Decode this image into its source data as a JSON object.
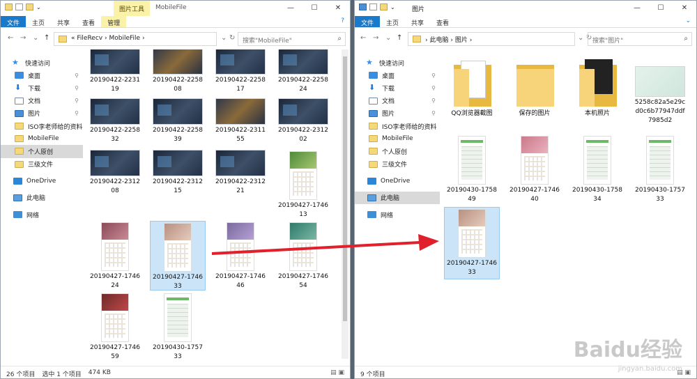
{
  "left": {
    "title": "MobileFile",
    "ctx_tab": "图片工具",
    "ribbon": [
      "文件",
      "主页",
      "共享",
      "查看",
      "管理"
    ],
    "path": [
      "«",
      "FileRecv",
      "›",
      "MobileFile",
      "›"
    ],
    "search_placeholder": "搜索\"MobileFile\"",
    "nav": [
      {
        "label": "快速访问",
        "icon": "star-icon"
      },
      {
        "label": "桌面",
        "icon": "desktop-icon",
        "pin": "true"
      },
      {
        "label": "下载",
        "icon": "download-icon",
        "pin": "true"
      },
      {
        "label": "文档",
        "icon": "document-icon",
        "pin": "true"
      },
      {
        "label": "图片",
        "icon": "pictures-icon",
        "pin": "true"
      },
      {
        "label": "ISO李老师给的资料",
        "icon": "folder-icon"
      },
      {
        "label": "MobileFile",
        "icon": "folder-icon"
      },
      {
        "label": "个人原创",
        "icon": "folder-icon",
        "selected": true
      },
      {
        "label": "三级文件",
        "icon": "folder-icon"
      },
      {
        "label": "OneDrive",
        "icon": "onedrive-icon"
      },
      {
        "label": "此电脑",
        "icon": "this-pc-icon"
      },
      {
        "label": "网络",
        "icon": "network-icon"
      }
    ],
    "files": [
      {
        "name": [
          "20190422-2231",
          "19"
        ],
        "kind": "land"
      },
      {
        "name": [
          "20190422-2258",
          "08"
        ],
        "kind": "hero"
      },
      {
        "name": [
          "20190422-2258",
          "17"
        ],
        "kind": "land"
      },
      {
        "name": [
          "20190422-2258",
          "24"
        ],
        "kind": "land"
      },
      {
        "name": [
          "20190422-2258",
          "32"
        ],
        "kind": "land"
      },
      {
        "name": [
          "20190422-2258",
          "39"
        ],
        "kind": "land"
      },
      {
        "name": [
          "20190422-2311",
          "55"
        ],
        "kind": "hero"
      },
      {
        "name": [
          "20190422-2312",
          "02"
        ],
        "kind": "land"
      },
      {
        "name": [
          "20190422-2312",
          "08"
        ],
        "kind": "land"
      },
      {
        "name": [
          "20190422-2312",
          "15"
        ],
        "kind": "land"
      },
      {
        "name": [
          "20190422-2312",
          "21"
        ],
        "kind": "land"
      },
      {
        "name": [
          "20190427-1746",
          "13"
        ],
        "kind": "cal3"
      },
      {
        "name": [
          "20190427-1746",
          "24"
        ],
        "kind": "cal1"
      },
      {
        "name": [
          "20190427-1746",
          "33"
        ],
        "kind": "cal6",
        "selected": true
      },
      {
        "name": [
          "20190427-1746",
          "46"
        ],
        "kind": "cal2"
      },
      {
        "name": [
          "20190427-1746",
          "54"
        ],
        "kind": "cal5"
      },
      {
        "name": [
          "20190427-1746",
          "59"
        ],
        "kind": "cal4"
      },
      {
        "name": [
          "20190430-1757",
          "33"
        ],
        "kind": "shot"
      }
    ],
    "status": {
      "count": "26 个项目",
      "selected": "选中 1 个项目",
      "size": "474 KB"
    }
  },
  "right": {
    "title": "图片",
    "ribbon": [
      "文件",
      "主页",
      "共享",
      "查看"
    ],
    "path": [
      "›",
      "此电脑",
      "›",
      "图片",
      "›"
    ],
    "search_placeholder": "搜索\"图片\"",
    "nav": [
      {
        "label": "快速访问",
        "icon": "star-icon"
      },
      {
        "label": "桌面",
        "icon": "desktop-icon",
        "pin": "true"
      },
      {
        "label": "下载",
        "icon": "download-icon",
        "pin": "true"
      },
      {
        "label": "文档",
        "icon": "document-icon",
        "pin": "true"
      },
      {
        "label": "图片",
        "icon": "pictures-icon",
        "pin": "true"
      },
      {
        "label": "ISO李老师给的资料",
        "icon": "folder-icon"
      },
      {
        "label": "MobileFile",
        "icon": "folder-icon"
      },
      {
        "label": "个人原创",
        "icon": "folder-icon"
      },
      {
        "label": "三级文件",
        "icon": "folder-icon"
      },
      {
        "label": "OneDrive",
        "icon": "onedrive-icon"
      },
      {
        "label": "此电脑",
        "icon": "this-pc-icon",
        "selected": true
      },
      {
        "label": "网络",
        "icon": "network-icon"
      }
    ],
    "files": [
      {
        "name": [
          "QQ浏览器截图"
        ],
        "kind": "folder-doc"
      },
      {
        "name": [
          "保存的图片"
        ],
        "kind": "folder"
      },
      {
        "name": [
          "本机照片"
        ],
        "kind": "folder-dark"
      },
      {
        "name": [
          "5258c82a5e29c",
          "d0c6b77947ddf",
          "7985d2"
        ],
        "kind": "lgt"
      },
      {
        "name": [
          "20190430-1758",
          "49"
        ],
        "kind": "shot"
      },
      {
        "name": [
          "20190427-1746",
          "40"
        ],
        "kind": "cal7"
      },
      {
        "name": [
          "20190430-1758",
          "34"
        ],
        "kind": "shot"
      },
      {
        "name": [
          "20190430-1757",
          "33"
        ],
        "kind": "shot"
      },
      {
        "name": [
          "20190427-1746",
          "33"
        ],
        "kind": "cal6",
        "selected": true
      }
    ],
    "status": {
      "count": "9 个项目"
    }
  },
  "win_controls": {
    "minimize": "—",
    "maximize": "☐",
    "close": "✕"
  },
  "nav_buttons": {
    "back": "←",
    "forward": "→",
    "recent": "⌄",
    "up": "↑",
    "refresh": "↻",
    "dropdown": "⌄",
    "search_icon": "⌕",
    "help": "?",
    "expand": "⌄"
  },
  "watermark": {
    "logo": "Baidu经验",
    "url": "jingyan.baidu.com"
  },
  "colors": {
    "accent": "#1979ca",
    "selection": "#cce4f7",
    "context_tab": "#faf2a8",
    "arrow": "#e0202a"
  }
}
